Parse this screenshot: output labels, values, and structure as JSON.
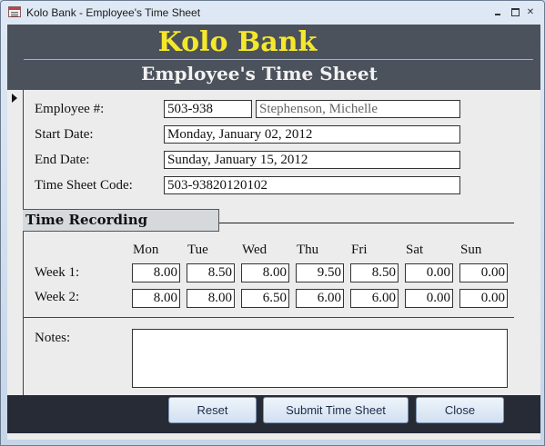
{
  "window": {
    "title": "Kolo Bank - Employee's Time Sheet",
    "controls": [
      "minimize",
      "restore",
      "close"
    ]
  },
  "header": {
    "bank_name": "Kolo Bank",
    "form_title": "Employee's Time Sheet",
    "colors": {
      "background": "#4c525c",
      "bank_name": "#f5e82a",
      "title": "#f2f2f2"
    }
  },
  "employee": {
    "number_label": "Employee #:",
    "number_value": "503-938",
    "name_value": "Stephenson, Michelle",
    "start_label": "Start Date:",
    "start_value": "Monday, January 02, 2012",
    "end_label": "End Date:",
    "end_value": "Sunday, January 15, 2012",
    "code_label": "Time Sheet Code:",
    "code_value": "503-93820120102"
  },
  "time_recording": {
    "section_label": "Time Recording",
    "days": [
      "Mon",
      "Tue",
      "Wed",
      "Thu",
      "Fri",
      "Sat",
      "Sun"
    ],
    "weeks": [
      {
        "label": "Week 1:",
        "hours": [
          "8.00",
          "8.50",
          "8.00",
          "9.50",
          "8.50",
          "0.00",
          "0.00"
        ]
      },
      {
        "label": "Week 2:",
        "hours": [
          "8.00",
          "8.00",
          "6.50",
          "6.00",
          "6.00",
          "0.00",
          "0.00"
        ]
      }
    ]
  },
  "notes": {
    "label": "Notes:",
    "value": ""
  },
  "footer": {
    "reset_label": "Reset",
    "submit_label": "Submit Time Sheet",
    "close_label": "Close"
  }
}
